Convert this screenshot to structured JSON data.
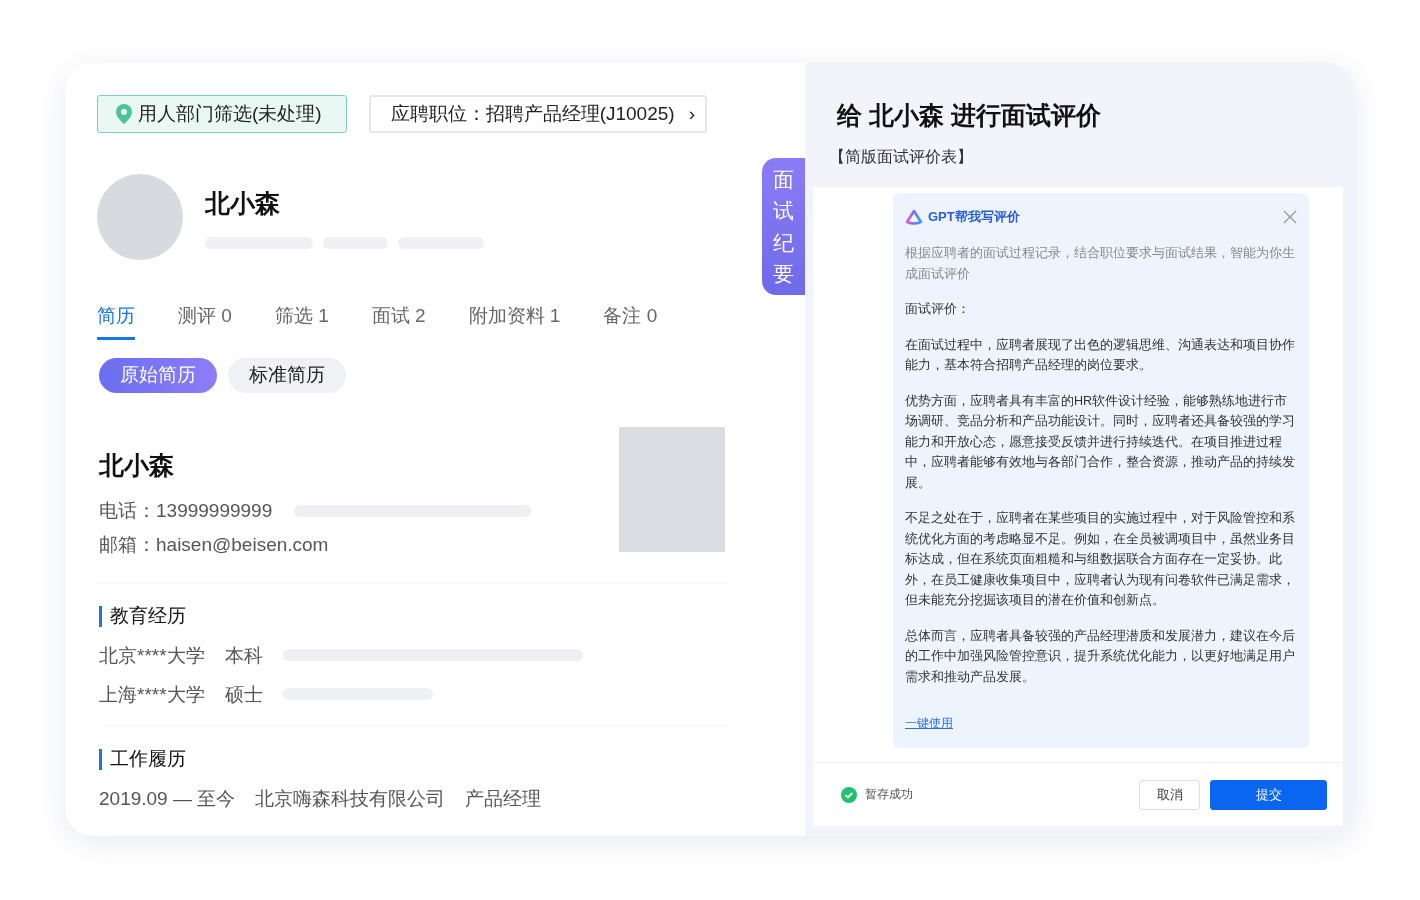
{
  "stage_tag": {
    "label": "用人部门筛选(未处理)"
  },
  "position_link": {
    "label": "应聘职位：招聘产品经理(J10025)",
    "chevron": "›"
  },
  "side_tab": {
    "label": "面试纪要"
  },
  "candidate": {
    "name": "北小森"
  },
  "tabs": [
    {
      "label": "简历",
      "selected": true
    },
    {
      "label": "测评 0",
      "selected": false
    },
    {
      "label": "筛选 1",
      "selected": false
    },
    {
      "label": "面试 2",
      "selected": false
    },
    {
      "label": "附加资料 1",
      "selected": false
    },
    {
      "label": "备注 0",
      "selected": false
    }
  ],
  "resume_views": [
    {
      "label": "原始简历",
      "selected": true
    },
    {
      "label": "标准简历",
      "selected": false
    }
  ],
  "resume": {
    "name": "北小森",
    "contacts": [
      {
        "label": "电话：",
        "value": "13999999999",
        "redacted": true
      },
      {
        "label": "邮箱：",
        "value": "haisen@beisen.com",
        "redacted": false
      }
    ],
    "sections": [
      {
        "title": "教育经历",
        "rows": [
          {
            "cells": [
              "北京****大学",
              "本科"
            ],
            "redacted": true
          },
          {
            "cells": [
              "上海****大学",
              "硕士"
            ],
            "redacted": true
          }
        ]
      },
      {
        "title": "工作履历",
        "rows": [
          {
            "cells": [
              "2019.09 — 至今",
              "北京嗨森科技有限公司",
              "产品经理"
            ],
            "redacted": false
          }
        ]
      }
    ]
  },
  "review": {
    "title": "给 北小森 进行面试评价",
    "subtitle": "【简版面试评价表】",
    "assistant": {
      "title": "GPT帮我写评价",
      "intro": "根据应聘者的面试过程记录，结合职位要求与面试结果，智能为你生成面试评价",
      "heading": "面试评价：",
      "paragraphs": [
        "在面试过程中，应聘者展现了出色的逻辑思维、沟通表达和项目协作能力，基本符合招聘产品经理的岗位要求。",
        "优势方面，应聘者具有丰富的HR软件设计经验，能够熟练地进行市场调研、竞品分析和产品功能设计。同时，应聘者还具备较强的学习能力和开放心态，愿意接受反馈并进行持续迭代。在项目推进过程中，应聘者能够有效地与各部门合作，整合资源，推动产品的持续发展。",
        "不足之处在于，应聘者在某些项目的实施过程中，对于风险管控和系统优化方面的考虑略显不足。例如，在全员被调项目中，虽然业务目标达成，但在系统页面粗糙和与组数据联合方面存在一定妥协。此外，在员工健康收集项目中，应聘者认为现有问卷软件已满足需求，但未能充分挖掘该项目的潜在价值和创新点。",
        "总体而言，应聘者具备较强的产品经理潜质和发展潜力，建议在今后的工作中加强风险管控意识，提升系统优化能力，以更好地满足用户需求和推动产品发展。"
      ],
      "action": "一键使用"
    },
    "status": {
      "label": "暂存成功"
    },
    "buttons": [
      {
        "label": "取消",
        "kind": "secondary"
      },
      {
        "label": "提交",
        "kind": "primary"
      }
    ]
  }
}
